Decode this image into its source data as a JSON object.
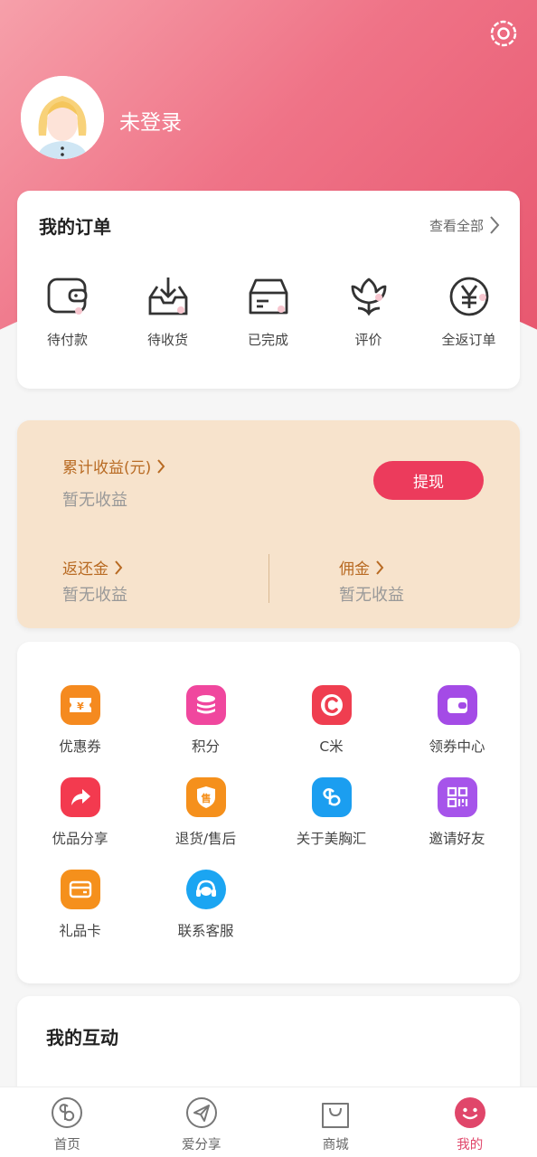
{
  "profile": {
    "status_label": "未登录"
  },
  "orders": {
    "title": "我的订单",
    "view_all": "查看全部",
    "items": [
      {
        "label": "待付款",
        "icon": "wallet-icon"
      },
      {
        "label": "待收货",
        "icon": "inbox-download-icon"
      },
      {
        "label": "已完成",
        "icon": "card-box-icon"
      },
      {
        "label": "评价",
        "icon": "flower-icon"
      },
      {
        "label": "全返订单",
        "icon": "yen-circle-icon"
      }
    ]
  },
  "earnings": {
    "total_label": "累计收益(元)",
    "total_value": "暂无收益",
    "withdraw_label": "提现",
    "rebate_label": "返还金",
    "rebate_value": "暂无收益",
    "commission_label": "佣金",
    "commission_value": "暂无收益"
  },
  "services": [
    {
      "label": "优惠券",
      "icon": "coupon-icon",
      "color": "#f58a1f"
    },
    {
      "label": "积分",
      "icon": "coins-icon",
      "color": "#f0479e"
    },
    {
      "label": "C米",
      "icon": "c-letter-icon",
      "color": "#ef3e50"
    },
    {
      "label": "领券中心",
      "icon": "wallet-purple-icon",
      "color": "#a44be6"
    },
    {
      "label": "优品分享",
      "icon": "share-arrow-icon",
      "color": "#f33a4f"
    },
    {
      "label": "退货/售后",
      "icon": "shield-sale-icon",
      "color": "#f5901c"
    },
    {
      "label": "关于美胸汇",
      "icon": "brand-logo-icon",
      "color": "#1b9ef0"
    },
    {
      "label": "邀请好友",
      "icon": "qr-code-icon",
      "color": "#a654ea"
    },
    {
      "label": "礼品卡",
      "icon": "gift-card-icon",
      "color": "#f5901c"
    },
    {
      "label": "联系客服",
      "icon": "headset-icon",
      "color": "#1ba5f2"
    }
  ],
  "interaction": {
    "title": "我的互动"
  },
  "tabbar": [
    {
      "label": "首页",
      "icon": "home-logo-icon",
      "active": false
    },
    {
      "label": "爱分享",
      "icon": "send-icon",
      "active": false
    },
    {
      "label": "商城",
      "icon": "shopping-bag-icon",
      "active": false
    },
    {
      "label": "我的",
      "icon": "smiley-icon",
      "active": true
    }
  ],
  "colors": {
    "accent": "#ec3b5c",
    "header_gradient_start": "#f6a0aa",
    "header_gradient_end": "#e7566e",
    "earnings_bg": "#f7e3cc",
    "earnings_text": "#b86a22",
    "tab_active": "#e0466a"
  }
}
